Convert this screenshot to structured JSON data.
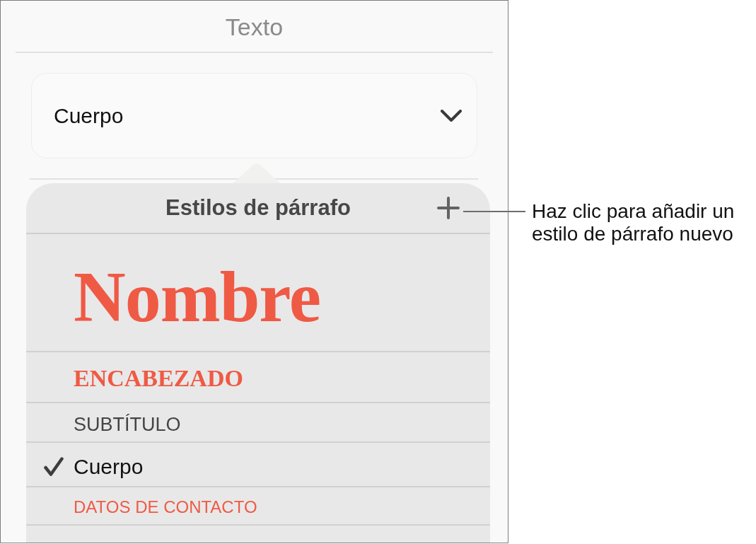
{
  "panel": {
    "title": "Texto"
  },
  "style_menu": {
    "value": "Cuerpo"
  },
  "paragraph_styles": {
    "title": "Estilos de párrafo",
    "items": [
      {
        "label": "Nombre",
        "kind": "name",
        "selected": false
      },
      {
        "label": "ENCABEZADO",
        "kind": "heading",
        "selected": false
      },
      {
        "label": "SUBTÍTULO",
        "kind": "subtitle",
        "selected": false
      },
      {
        "label": "Cuerpo",
        "kind": "body",
        "selected": true
      },
      {
        "label": "DATOS DE CONTACTO",
        "kind": "contact",
        "selected": false
      }
    ]
  },
  "callout": {
    "text": "Haz clic para añadir un estilo de párrafo nuevo"
  }
}
